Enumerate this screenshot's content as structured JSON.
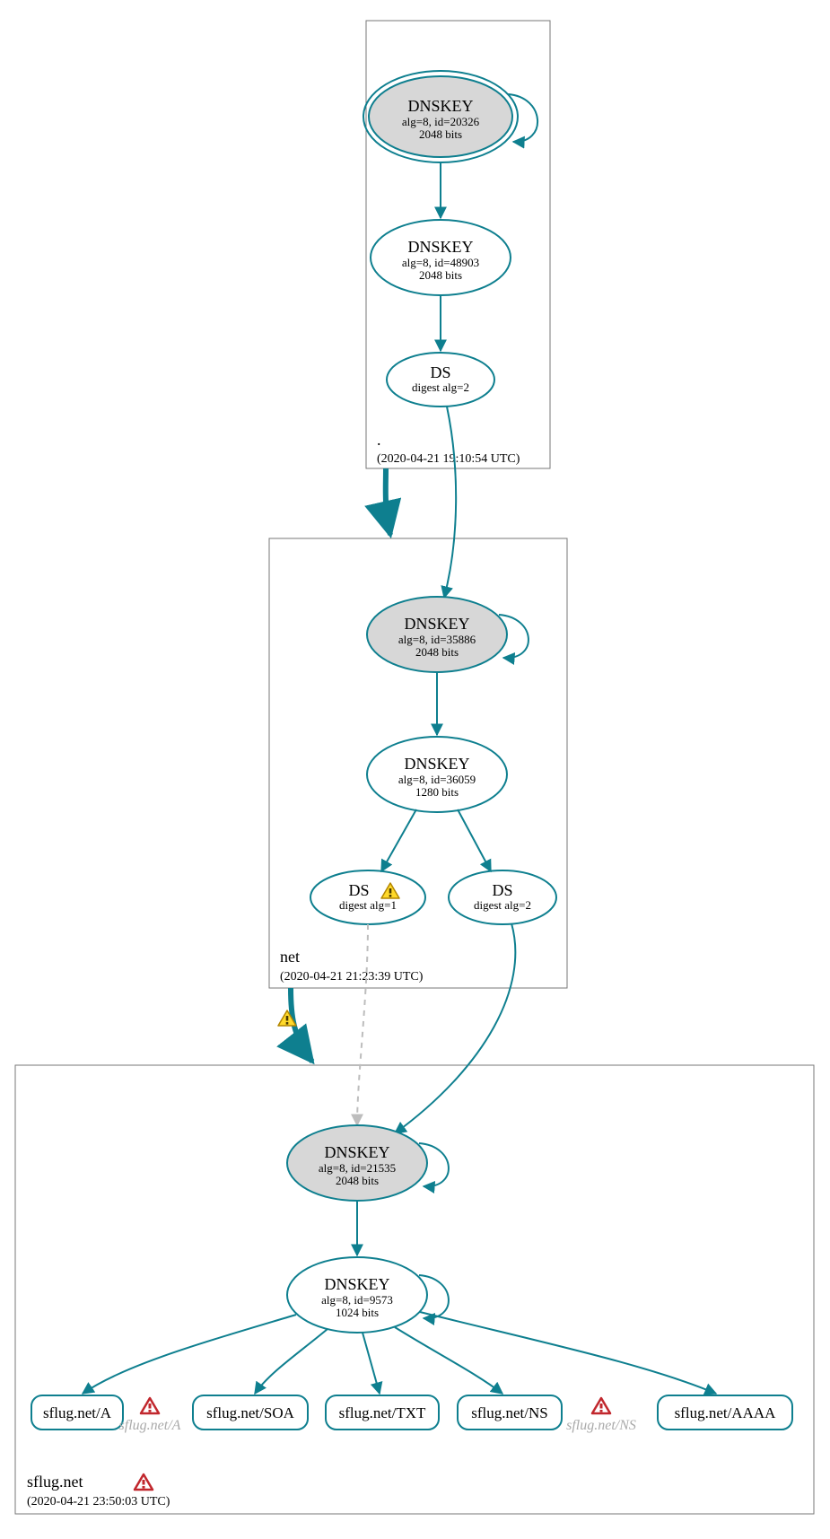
{
  "colors": {
    "stroke": "#0e7f8f",
    "fill_gray": "#d7d7d7",
    "box_stroke": "#777777",
    "faded": "#bdbdbd",
    "warn_fill": "#ffd92a",
    "warn_stroke": "#aa8800",
    "err_fill": "#ffffff",
    "err_stroke": "#c1272d"
  },
  "zones": {
    "root": {
      "label": ".",
      "timestamp": "(2020-04-21 19:10:54 UTC)",
      "nodes": {
        "ksk": {
          "title": "DNSKEY",
          "line1": "alg=8, id=20326",
          "line2": "2048 bits"
        },
        "zsk": {
          "title": "DNSKEY",
          "line1": "alg=8, id=48903",
          "line2": "2048 bits"
        },
        "ds": {
          "title": "DS",
          "line1": "digest alg=2"
        }
      }
    },
    "net": {
      "label": "net",
      "timestamp": "(2020-04-21 21:23:39 UTC)",
      "nodes": {
        "ksk": {
          "title": "DNSKEY",
          "line1": "alg=8, id=35886",
          "line2": "2048 bits"
        },
        "zsk": {
          "title": "DNSKEY",
          "line1": "alg=8, id=36059",
          "line2": "1280 bits"
        },
        "ds1": {
          "title": "DS",
          "line1": "digest alg=1",
          "warning": true
        },
        "ds2": {
          "title": "DS",
          "line1": "digest alg=2"
        }
      }
    },
    "sflug": {
      "label": "sflug.net",
      "timestamp": "(2020-04-21 23:50:03 UTC)",
      "error": true,
      "nodes": {
        "ksk": {
          "title": "DNSKEY",
          "line1": "alg=8, id=21535",
          "line2": "2048 bits"
        },
        "zsk": {
          "title": "DNSKEY",
          "line1": "alg=8, id=9573",
          "line2": "1024 bits"
        }
      },
      "records": {
        "a": {
          "label": "sflug.net/A"
        },
        "a_err": {
          "label": "sflug.net/A",
          "error": true
        },
        "soa": {
          "label": "sflug.net/SOA"
        },
        "txt": {
          "label": "sflug.net/TXT"
        },
        "ns": {
          "label": "sflug.net/NS"
        },
        "ns_err": {
          "label": "sflug.net/NS",
          "error": true
        },
        "aaaa": {
          "label": "sflug.net/AAAA"
        }
      }
    }
  },
  "chart_data": {
    "type": "dnssec-authentication-graph",
    "zones": [
      {
        "name": ".",
        "timestamp": "2020-04-21 19:10:54 UTC",
        "keys": [
          {
            "role": "KSK",
            "type": "DNSKEY",
            "algorithm": 8,
            "id": 20326,
            "bits": 2048,
            "trust_anchor": true,
            "self_signed": true
          },
          {
            "role": "ZSK",
            "type": "DNSKEY",
            "algorithm": 8,
            "id": 48903,
            "bits": 2048
          }
        ],
        "ds": [
          {
            "digest_algorithm": 2,
            "delegates": "net"
          }
        ]
      },
      {
        "name": "net",
        "timestamp": "2020-04-21 21:23:39 UTC",
        "keys": [
          {
            "role": "KSK",
            "type": "DNSKEY",
            "algorithm": 8,
            "id": 35886,
            "bits": 2048,
            "self_signed": true
          },
          {
            "role": "ZSK",
            "type": "DNSKEY",
            "algorithm": 8,
            "id": 36059,
            "bits": 1280
          }
        ],
        "ds": [
          {
            "digest_algorithm": 1,
            "delegates": "sflug.net",
            "status": "warning",
            "edge_status": "insecure"
          },
          {
            "digest_algorithm": 2,
            "delegates": "sflug.net",
            "status": "secure"
          }
        ]
      },
      {
        "name": "sflug.net",
        "timestamp": "2020-04-21 23:50:03 UTC",
        "zone_status": "error",
        "delegation_status": "warning",
        "keys": [
          {
            "role": "KSK",
            "type": "DNSKEY",
            "algorithm": 8,
            "id": 21535,
            "bits": 2048,
            "self_signed": true
          },
          {
            "role": "ZSK",
            "type": "DNSKEY",
            "algorithm": 8,
            "id": 9573,
            "bits": 1024,
            "self_signed": true
          }
        ],
        "rrsets": [
          {
            "name": "sflug.net/A",
            "status": "secure"
          },
          {
            "name": "sflug.net/A",
            "status": "error"
          },
          {
            "name": "sflug.net/SOA",
            "status": "secure"
          },
          {
            "name": "sflug.net/TXT",
            "status": "secure"
          },
          {
            "name": "sflug.net/NS",
            "status": "secure"
          },
          {
            "name": "sflug.net/NS",
            "status": "error"
          },
          {
            "name": "sflug.net/AAAA",
            "status": "secure"
          }
        ]
      }
    ],
    "edges": [
      {
        "from": "./DNSKEY/20326",
        "to": "./DNSKEY/20326",
        "type": "self-sig"
      },
      {
        "from": "./DNSKEY/20326",
        "to": "./DNSKEY/48903",
        "type": "rrsig"
      },
      {
        "from": "./DNSKEY/48903",
        "to": "./DS(alg=2)",
        "type": "rrsig"
      },
      {
        "from": "./DS(alg=2)",
        "to": "net/DNSKEY/35886",
        "type": "ds"
      },
      {
        "from": "net/DNSKEY/35886",
        "to": "net/DNSKEY/35886",
        "type": "self-sig"
      },
      {
        "from": "net/DNSKEY/35886",
        "to": "net/DNSKEY/36059",
        "type": "rrsig"
      },
      {
        "from": "net/DNSKEY/36059",
        "to": "net/DS(alg=1)",
        "type": "rrsig"
      },
      {
        "from": "net/DNSKEY/36059",
        "to": "net/DS(alg=2)",
        "type": "rrsig"
      },
      {
        "from": "net/DS(alg=1)",
        "to": "sflug.net/DNSKEY/21535",
        "type": "ds",
        "status": "insecure"
      },
      {
        "from": "net/DS(alg=2)",
        "to": "sflug.net/DNSKEY/21535",
        "type": "ds"
      },
      {
        "from": "sflug.net/DNSKEY/21535",
        "to": "sflug.net/DNSKEY/21535",
        "type": "self-sig"
      },
      {
        "from": "sflug.net/DNSKEY/21535",
        "to": "sflug.net/DNSKEY/9573",
        "type": "rrsig"
      },
      {
        "from": "sflug.net/DNSKEY/9573",
        "to": "sflug.net/DNSKEY/9573",
        "type": "self-sig"
      },
      {
        "from": "sflug.net/DNSKEY/9573",
        "to": "sflug.net/A",
        "type": "rrsig"
      },
      {
        "from": "sflug.net/DNSKEY/9573",
        "to": "sflug.net/SOA",
        "type": "rrsig"
      },
      {
        "from": "sflug.net/DNSKEY/9573",
        "to": "sflug.net/TXT",
        "type": "rrsig"
      },
      {
        "from": "sflug.net/DNSKEY/9573",
        "to": "sflug.net/NS",
        "type": "rrsig"
      },
      {
        "from": "sflug.net/DNSKEY/9573",
        "to": "sflug.net/AAAA",
        "type": "rrsig"
      }
    ]
  }
}
